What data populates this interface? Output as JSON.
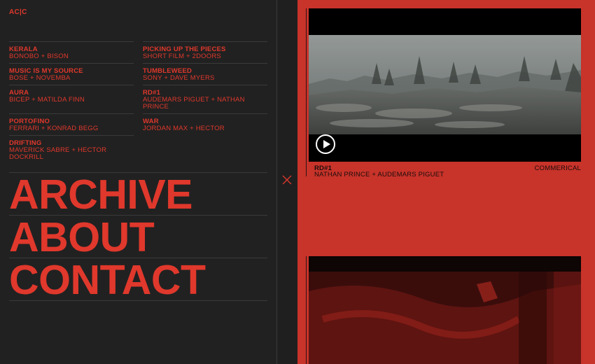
{
  "brand": {
    "logo": "AC|C"
  },
  "projects": {
    "left": [
      {
        "title": "KERALA",
        "subtitle": "BONOBO + BISON"
      },
      {
        "title": "MUSIC IS MY SOURCE",
        "subtitle": "BOSE + NOVEMBA"
      },
      {
        "title": "AURA",
        "subtitle": "BICEP + MATILDA FINN"
      },
      {
        "title": "PORTOFINO",
        "subtitle": "FERRARI + KONRAD BEGG"
      },
      {
        "title": "DRIFTING",
        "subtitle": "MAVERICK SABRE + HECTOR DOCKRILL"
      }
    ],
    "right": [
      {
        "title": "PICKING UP THE PIECES",
        "subtitle": "SHORT FILM + 2DOORS"
      },
      {
        "title": "TUMBLEWEED",
        "subtitle": "SONY + DAVE MYERS"
      },
      {
        "title": "RD#1",
        "subtitle": "AUDEMARS PIGUET + NATHAN PRINCE"
      },
      {
        "title": "WAR",
        "subtitle": "JORDAN MAX + HECTOR"
      }
    ]
  },
  "nav": {
    "archive": "ARCHIVE",
    "about": "ABOUT",
    "contact": "CONTACT"
  },
  "icons": {
    "close": "close-icon",
    "play": "play-icon"
  },
  "featured": {
    "title": "RD#1",
    "subtitle": "NATHAN PRINCE + AUDEMARS PIGUET",
    "category": "COMMERICAL"
  },
  "colors": {
    "accent": "#e0382c",
    "panel_red": "#c8332a",
    "dark": "#212121"
  }
}
